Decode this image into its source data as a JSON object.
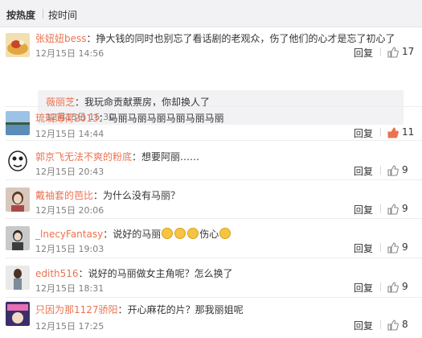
{
  "sort": {
    "hot_label": "按热度",
    "time_label": "按时间"
  },
  "reply_label": "回复",
  "comments": [
    {
      "user": "张妞妞bess",
      "content": "挣大钱的同时也别忘了看话剧的老观众，伤了他们的心才是忘了初心了",
      "time": "12月15日 14:56",
      "likes": "17"
    },
    {
      "user": "琉璃薄荷2013",
      "content": "马丽马丽马丽马丽马丽马丽",
      "time": "12月15日 14:44",
      "likes": "11"
    },
    {
      "user": "郭京飞无法不爽的粉底",
      "content": "想要阿丽……",
      "time": "12月15日 20:43",
      "likes": "9"
    },
    {
      "user": "戴袖套的芭比",
      "content": "为什么没有马丽？",
      "time": "12月15日 20:06",
      "likes": "9"
    },
    {
      "user": "_lnecyFantasy",
      "content_before": "说好的马丽",
      "content_after": "伤心",
      "time": "12月15日 19:03",
      "likes": "9"
    },
    {
      "user": "edith516",
      "content": "说好的马丽做女主角呢？怎么换了",
      "time": "12月15日 18:31",
      "likes": "9"
    },
    {
      "user": "只因为那1127骄阳",
      "content": "开心麻花的片？那我丽姐呢",
      "time": "12月15日 17:25",
      "likes": "8"
    }
  ],
  "subreply": {
    "user": "薇丽芝",
    "content": "我玩命贡献票房，你却换人了",
    "time": "12月15日 15:30"
  },
  "colors": {
    "username": "#eb7350",
    "like_active": "#eb7350",
    "sortbar_bg": "#f2f2f5"
  }
}
